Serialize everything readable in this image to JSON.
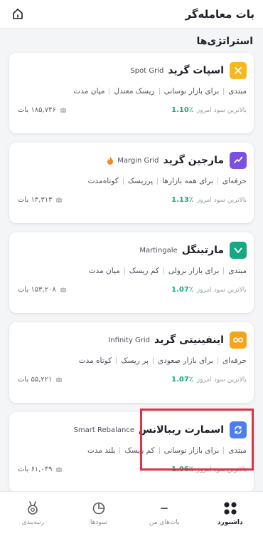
{
  "header": {
    "title": "بات معامله‌گر"
  },
  "section": {
    "title": "استراتژی‌ها"
  },
  "strategies": [
    {
      "name": "اسپات گرید",
      "en": "Spot Grid",
      "icon": "grid-icon",
      "color": "#f5b820",
      "tags": [
        "مبتدی",
        "برای بازار نوسانی",
        "ریسک معتدل",
        "میان مدت"
      ],
      "profit_label": "بالاترین سود امروز",
      "profit": "1.10٪",
      "users": "۱۸۵,۷۴۶ بات"
    },
    {
      "name": "مارجین گرید",
      "en": "Margin Grid",
      "icon": "trend-icon",
      "color": "#7b4fe0",
      "hot": true,
      "tags": [
        "حرفه‌ای",
        "برای همه بازارها",
        "پرریسک",
        "کوتاه‌مدت"
      ],
      "profit_label": "بالاترین سود امروز",
      "profit": "1.13٪",
      "users": "۱۳,۳۱۳ بات"
    },
    {
      "name": "مارتینگل",
      "en": "Martingale",
      "icon": "chevron-icon",
      "color": "#17a883",
      "tags": [
        "مبتدی",
        "برای بازار نزولی",
        "کم ریسک",
        "میان مدت"
      ],
      "profit_label": "بالاترین سود امروز",
      "profit": "1.07٪",
      "users": "۱۵۳,۲۰۸ بات"
    },
    {
      "name": "اینفینیتی گرید",
      "en": "Infinity Grid",
      "icon": "infinity-icon",
      "color": "#f7a41c",
      "tags": [
        "حرفه‌ای",
        "برای بازار صعودی",
        "پر ریسک",
        "کوتاه مدت"
      ],
      "profit_label": "بالاترین سود امروز",
      "profit": "1.07٪",
      "users": "۵۵,۲۲۱ بات"
    },
    {
      "name": "اسمارت ریبالانس",
      "en": "Smart Rebalance",
      "icon": "rebalance-icon",
      "color": "#4d7ef0",
      "tags": [
        "مبتدی",
        "برای بازار نوسانی",
        "کم ریسک",
        "بلند مدت"
      ],
      "profit_label": "بالاترین سود امروز",
      "profit": "1.06٪",
      "users": "۶۱,۰۴۹ بات"
    }
  ],
  "nav": [
    {
      "label": "داشبورد",
      "icon": "dashboard-icon",
      "active": true
    },
    {
      "label": "بات‌های من",
      "icon": "bots-icon"
    },
    {
      "label": "سودها",
      "icon": "pie-icon"
    },
    {
      "label": "رتبه‌بندی",
      "icon": "medal-icon"
    }
  ]
}
